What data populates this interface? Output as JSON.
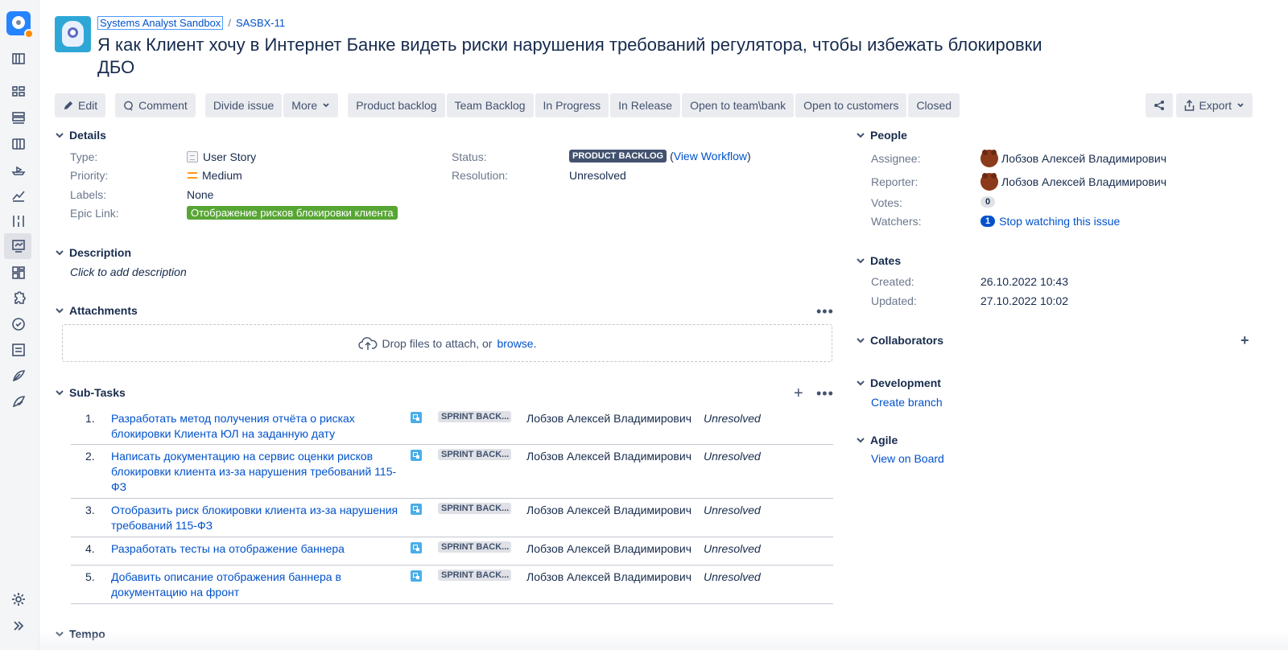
{
  "breadcrumb": {
    "project": "Systems Analyst Sandbox",
    "separator": "/",
    "issue_key": "SASBX-11"
  },
  "issue": {
    "summary": "Я как Клиент хочу в Интернет Банке видеть риски нарушения требований регулятора, чтобы избежать блокировки ДБО"
  },
  "toolbar": {
    "edit": "Edit",
    "comment": "Comment",
    "divide": "Divide issue",
    "more": "More",
    "workflow": [
      "Product backlog",
      "Team Backlog",
      "In Progress",
      "In Release",
      "Open to team\\bank",
      "Open to customers",
      "Closed"
    ],
    "export": "Export"
  },
  "details": {
    "title": "Details",
    "type_label": "Type:",
    "type_value": "User Story",
    "priority_label": "Priority:",
    "priority_value": "Medium",
    "labels_label": "Labels:",
    "labels_value": "None",
    "epic_label": "Epic Link:",
    "epic_value": "Отображение рисков блокировки клиента",
    "status_label": "Status:",
    "status_value": "PRODUCT BACKLOG",
    "view_workflow_open": "(",
    "view_workflow": "View Workflow",
    "view_workflow_close": ")",
    "resolution_label": "Resolution:",
    "resolution_value": "Unresolved"
  },
  "description": {
    "title": "Description",
    "placeholder": "Click to add description"
  },
  "attachments": {
    "title": "Attachments",
    "drop_text": "Drop files to attach, or",
    "browse": "browse."
  },
  "subtasks": {
    "title": "Sub-Tasks",
    "rows": [
      {
        "num": "1.",
        "summary": "Разработать метод получения отчёта о рисках блокировки Клиента ЮЛ на заданную дату",
        "status": "SPRINT BACK...",
        "assignee": "Лобзов Алексей Владимирович",
        "resolution": "Unresolved"
      },
      {
        "num": "2.",
        "summary": "Написать документацию на сервис оценки рисков блокировки клиента из-за нарушения требований 115-ФЗ",
        "status": "SPRINT BACK...",
        "assignee": "Лобзов Алексей Владимирович",
        "resolution": "Unresolved"
      },
      {
        "num": "3.",
        "summary": "Отобразить риск блокировки клиента из-за нарушения требований 115-ФЗ",
        "status": "SPRINT BACK...",
        "assignee": "Лобзов Алексей Владимирович",
        "resolution": "Unresolved"
      },
      {
        "num": "4.",
        "summary": "Разработать тесты на отображение баннера",
        "status": "SPRINT BACK...",
        "assignee": "Лобзов Алексей Владимирович",
        "resolution": "Unresolved"
      },
      {
        "num": "5.",
        "summary": "Добавить описание отображения баннера в документацию на фронт",
        "status": "SPRINT BACK...",
        "assignee": "Лобзов Алексей Владимирович",
        "resolution": "Unresolved"
      }
    ]
  },
  "tempo": {
    "title": "Tempo"
  },
  "people": {
    "title": "People",
    "assignee_label": "Assignee:",
    "assignee": "Лобзов Алексей Владимирович",
    "reporter_label": "Reporter:",
    "reporter": "Лобзов Алексей Владимирович",
    "votes_label": "Votes:",
    "votes": "0",
    "watchers_label": "Watchers:",
    "watchers": "1",
    "watch_link": "Stop watching this issue"
  },
  "dates": {
    "title": "Dates",
    "created_label": "Created:",
    "created": "26.10.2022 10:43",
    "updated_label": "Updated:",
    "updated": "27.10.2022 10:02"
  },
  "collaborators": {
    "title": "Collaborators"
  },
  "development": {
    "title": "Development",
    "create_branch": "Create branch"
  },
  "agile": {
    "title": "Agile",
    "view_board": "View on Board"
  },
  "colors": {
    "link": "#0052cc",
    "epic": "#57a634",
    "status_dark": "#42526e",
    "priority": "#ff991f"
  }
}
